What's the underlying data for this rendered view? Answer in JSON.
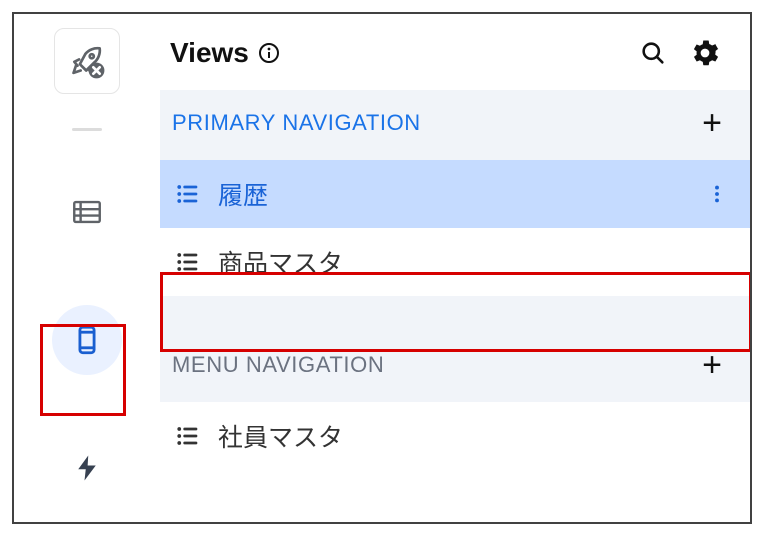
{
  "header": {
    "title": "Views"
  },
  "sections": [
    {
      "title": "PRIMARY NAVIGATION",
      "items": [
        {
          "label": "履歴"
        },
        {
          "label": "商品マスタ"
        }
      ]
    },
    {
      "title": "MENU NAVIGATION",
      "items": [
        {
          "label": "社員マスタ"
        }
      ]
    }
  ]
}
